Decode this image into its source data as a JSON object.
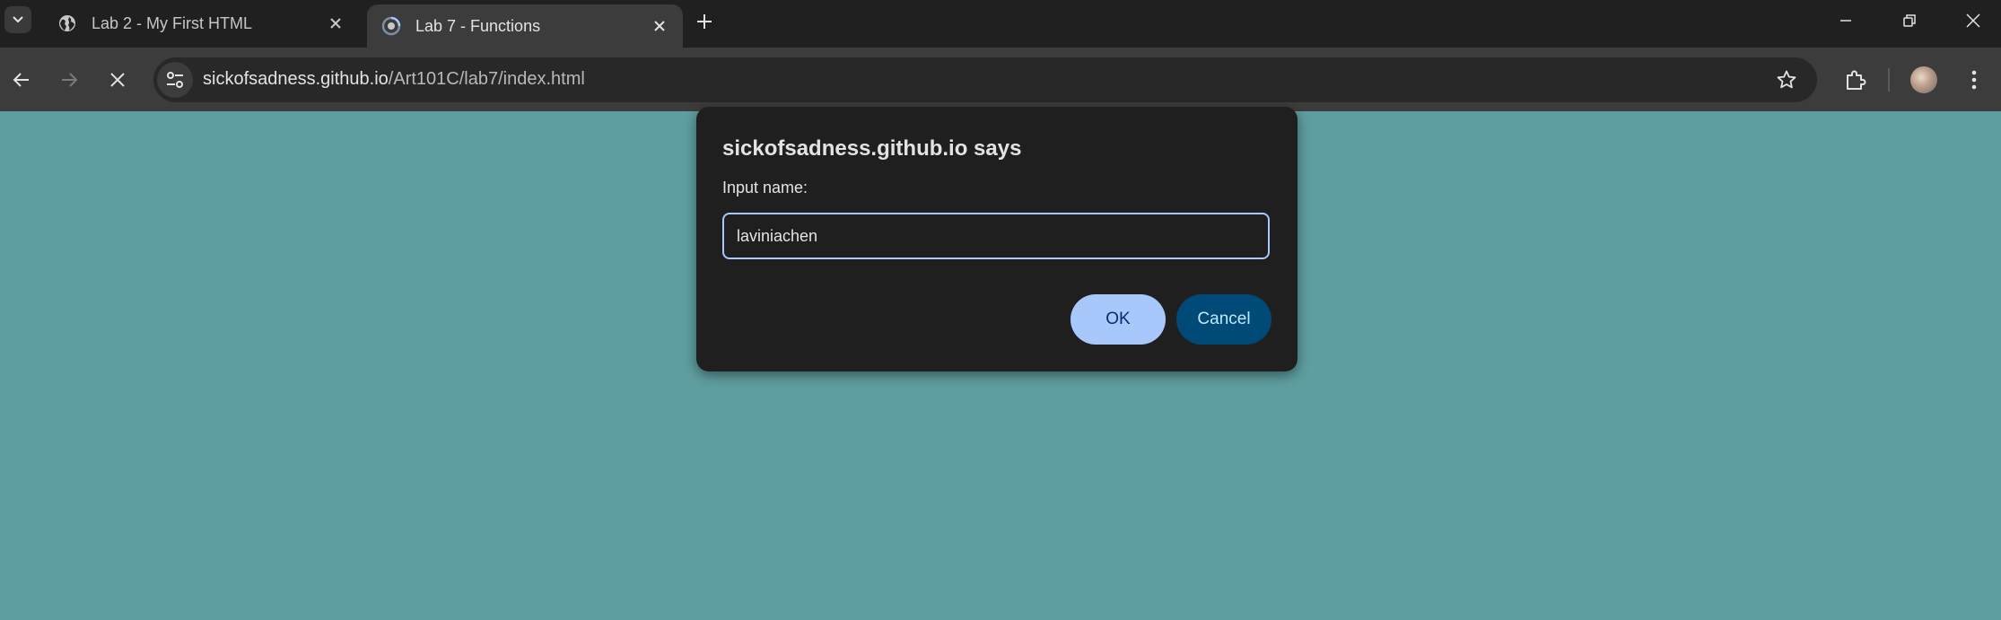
{
  "tabs": [
    {
      "title": "Lab 2 - My First HTML",
      "favicon": "globe-icon",
      "active": false
    },
    {
      "title": "Lab 7 - Functions",
      "favicon": "loading-icon",
      "active": true
    }
  ],
  "toolbar": {
    "url_host": "sickofsadness.github.io",
    "url_path": "/Art101C/lab7/index.html"
  },
  "dialog": {
    "title": "sickofsadness.github.io says",
    "message": "Input name:",
    "input_value": "laviniachen",
    "ok_label": "OK",
    "cancel_label": "Cancel"
  },
  "colors": {
    "page_background": "#5f9ea0",
    "dialog_background": "#1f1f1f",
    "ok_button": "#a8c7fa",
    "cancel_button": "#004a77"
  }
}
